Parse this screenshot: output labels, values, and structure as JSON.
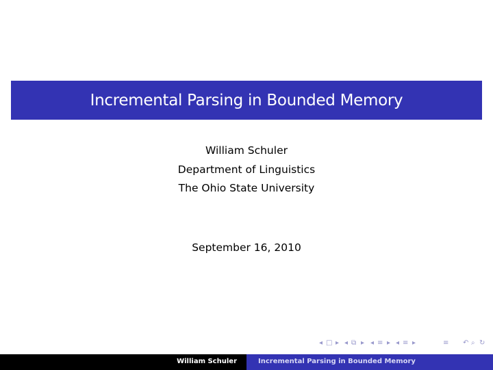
{
  "title": "Incremental Parsing in Bounded Memory",
  "author": "William Schuler",
  "department": "Department of Linguistics",
  "institution": "The Ohio State University",
  "date": "September 16, 2010",
  "navigation": {
    "icons": [
      "◂",
      "□",
      "▸",
      "◂",
      "⧉",
      "▸",
      "◂",
      "≡",
      "▸",
      "◂",
      "≡",
      "▸",
      "≡",
      "↶",
      "⌕",
      "↻"
    ]
  },
  "footer": {
    "author": "William Schuler",
    "title": "Incremental Parsing in Bounded Memory"
  }
}
